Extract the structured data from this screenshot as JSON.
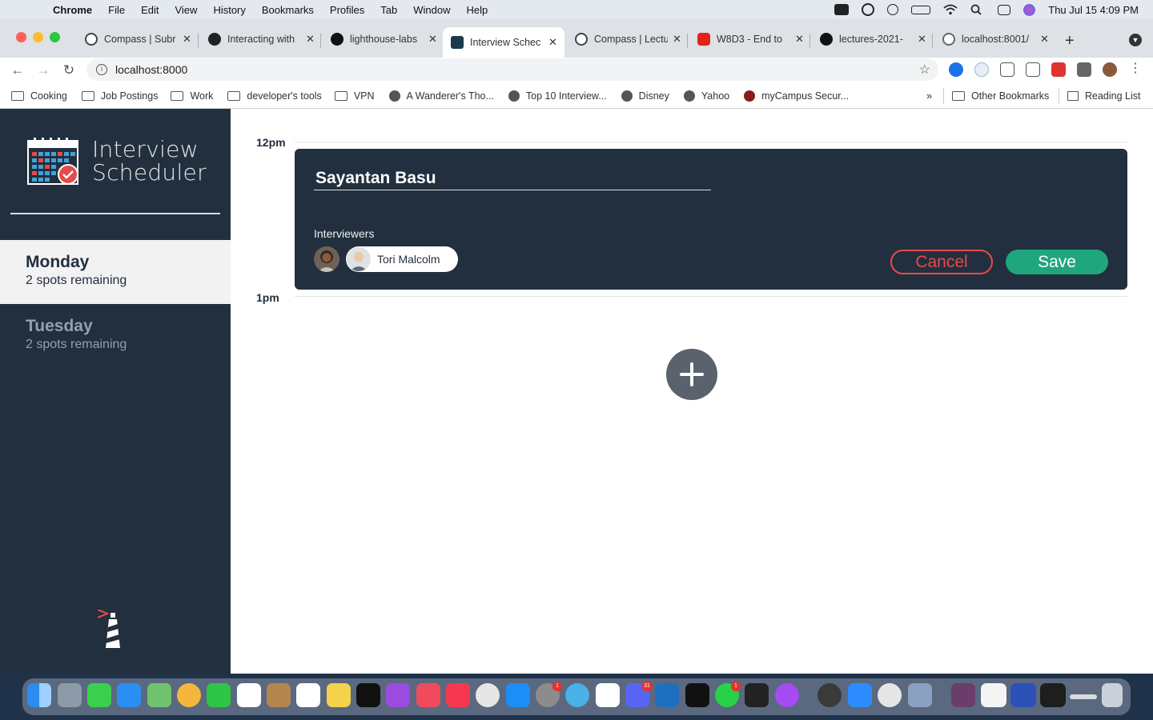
{
  "menubar": {
    "app": "Chrome",
    "items": [
      "File",
      "Edit",
      "View",
      "History",
      "Bookmarks",
      "Profiles",
      "Tab",
      "Window",
      "Help"
    ],
    "clock": "Thu Jul 15  4:09 PM"
  },
  "tabs": [
    {
      "title": "Compass | Subr",
      "color": "#444"
    },
    {
      "title": "Interacting with",
      "color": "#222"
    },
    {
      "title": "lighthouse-labs",
      "color": "#111"
    },
    {
      "title": "Interview Schec",
      "color": "#1b3a4b",
      "active": true
    },
    {
      "title": "Compass | Lectu",
      "color": "#444"
    },
    {
      "title": "W8D3 - End to",
      "color": "#e62117"
    },
    {
      "title": "lectures-2021-",
      "color": "#111"
    },
    {
      "title": "localhost:8001/",
      "color": "#666"
    }
  ],
  "address": {
    "url": "localhost:8000"
  },
  "bookmarks": {
    "items": [
      {
        "label": "Cooking",
        "type": "folder"
      },
      {
        "label": "Job Postings",
        "type": "folder"
      },
      {
        "label": "Work",
        "type": "folder"
      },
      {
        "label": "developer's tools",
        "type": "folder"
      },
      {
        "label": "VPN",
        "type": "folder"
      },
      {
        "label": "A Wanderer's Tho...",
        "type": "globe"
      },
      {
        "label": "Top 10 Interview...",
        "type": "globe"
      },
      {
        "label": "Disney",
        "type": "globe"
      },
      {
        "label": "Yahoo",
        "type": "globe"
      },
      {
        "label": "myCampus Secur...",
        "type": "globe"
      }
    ],
    "more": "»",
    "other": "Other Bookmarks",
    "reading_list": "Reading List"
  },
  "app": {
    "brand_line1": "Interview",
    "brand_line2": "Scheduler",
    "days": [
      {
        "name": "Monday",
        "spots": "2 spots remaining",
        "selected": true
      },
      {
        "name": "Tuesday",
        "spots": "2 spots remaining",
        "selected": false
      }
    ],
    "slots": [
      {
        "time": "12pm"
      },
      {
        "time": "1pm"
      }
    ],
    "form": {
      "student_name": "Sayantan Basu",
      "interviewers_label": "Interviewers",
      "selected_interviewer": "Tori Malcolm",
      "cancel": "Cancel",
      "save": "Save"
    }
  },
  "colors": {
    "sidebar": "#222f3e",
    "save": "#20a67d",
    "cancel": "#e84a4a"
  },
  "dock": {
    "badges": [
      "1",
      "31",
      "1"
    ]
  }
}
